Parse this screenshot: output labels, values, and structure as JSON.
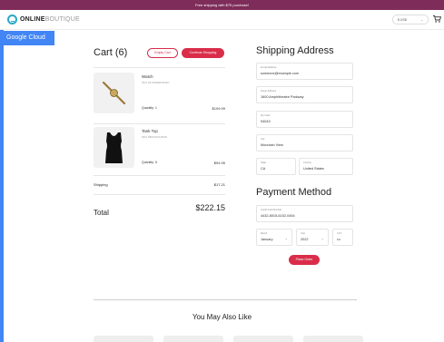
{
  "promo": {
    "text": "Free shipping with $75 purchase!"
  },
  "header": {
    "logo_bold": "ONLINE",
    "logo_thin": "BOUTIQUE",
    "currency": "$ USD",
    "currency_caret": "⌄",
    "cart_icon": "cart-icon"
  },
  "badge": {
    "text": "Google Cloud"
  },
  "cart": {
    "title": "Cart (6)",
    "empty_label": "Empty Cart",
    "continue_label": "Continue Shopping",
    "items": [
      {
        "name": "Watch",
        "sku": "SKU #1YMWWN1N4O",
        "qty": "Quantity: 1",
        "price": "$109.99"
      },
      {
        "name": "Tank Top",
        "sku": "SKU #66VCHSJNUP",
        "qty": "Quantity: 5",
        "price": "$94.95"
      }
    ],
    "shipping_label": "Shipping",
    "shipping_value": "$17.21",
    "total_label": "Total",
    "total_value": "$222.15"
  },
  "shipping": {
    "title": "Shipping Address",
    "email": {
      "label": "E-mail Address",
      "value": "someone@example.com"
    },
    "street": {
      "label": "Street Address",
      "value": "1600 Amphitheatre Parkway"
    },
    "zip": {
      "label": "Zip Code",
      "value": "94043"
    },
    "city": {
      "label": "City",
      "value": "Mountain View"
    },
    "state": {
      "label": "State",
      "value": "CA"
    },
    "country": {
      "label": "Country",
      "value": "United States"
    }
  },
  "payment": {
    "title": "Payment Method",
    "card": {
      "label": "Credit Card Number",
      "value": "4432-8015-6152-0454"
    },
    "month": {
      "label": "Month",
      "value": "January"
    },
    "year": {
      "label": "Year",
      "value": "2022"
    },
    "cvv": {
      "label": "CVV",
      "value": "•••"
    },
    "chevron": "⌄",
    "place_order_label": "Place Order"
  },
  "recommendations": {
    "title": "You May Also Like"
  },
  "colors": {
    "accent": "#d92d4a",
    "promo_bar": "#7e2d5a",
    "badge": "#4285f4"
  }
}
